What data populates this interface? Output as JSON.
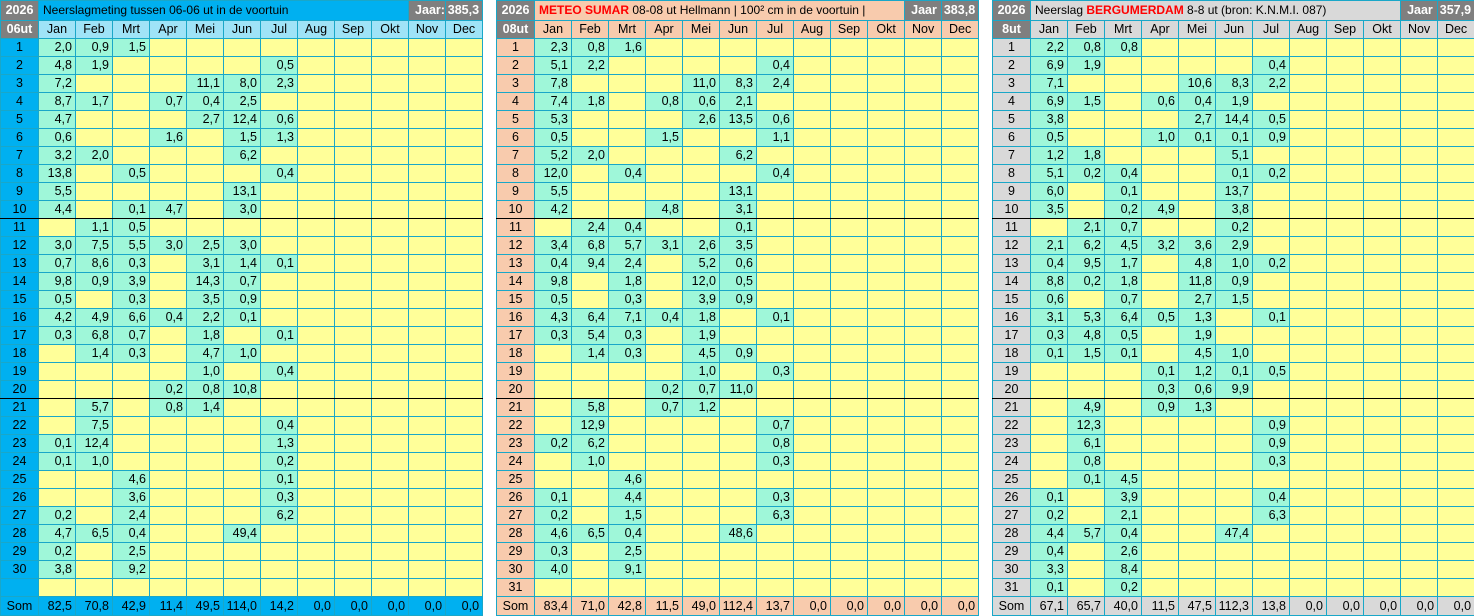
{
  "months": [
    "Jan",
    "Feb",
    "Mrt",
    "Apr",
    "Mei",
    "Jun",
    "Jul",
    "Aug",
    "Sep",
    "Okt",
    "Nov",
    "Dec"
  ],
  "som_label": "Som",
  "panels": [
    {
      "year": "2026",
      "hour": "06ut",
      "title_pre": "Neerslagmeting tussen 06-06 ut in de voortuin",
      "title_hl": "",
      "title_post": "",
      "jaar_label": "Jaar:",
      "jaar_value": "385,3",
      "rows": [
        [
          "2,0",
          "0,9",
          "1,5",
          "",
          "",
          "",
          "",
          "",
          "",
          "",
          "",
          ""
        ],
        [
          "4,8",
          "1,9",
          "",
          "",
          "",
          "",
          "0,5",
          "",
          "",
          "",
          "",
          ""
        ],
        [
          "7,2",
          "",
          "",
          "",
          "11,1",
          "8,0",
          "2,3",
          "",
          "",
          "",
          "",
          ""
        ],
        [
          "8,7",
          "1,7",
          "",
          "0,7",
          "0,4",
          "2,5",
          "",
          "",
          "",
          "",
          "",
          ""
        ],
        [
          "4,7",
          "",
          "",
          "",
          "2,7",
          "12,4",
          "0,6",
          "",
          "",
          "",
          "",
          ""
        ],
        [
          "0,6",
          "",
          "",
          "1,6",
          "",
          "1,5",
          "1,3",
          "",
          "",
          "",
          "",
          ""
        ],
        [
          "3,2",
          "2,0",
          "",
          "",
          "",
          "6,2",
          "",
          "",
          "",
          "",
          "",
          ""
        ],
        [
          "13,8",
          "",
          "0,5",
          "",
          "",
          "",
          "0,4",
          "",
          "",
          "",
          "",
          ""
        ],
        [
          "5,5",
          "",
          "",
          "",
          "",
          "13,1",
          "",
          "",
          "",
          "",
          "",
          ""
        ],
        [
          "4,4",
          "",
          "0,1",
          "4,7",
          "",
          "3,0",
          "",
          "",
          "",
          "",
          "",
          ""
        ],
        [
          "",
          "1,1",
          "0,5",
          "",
          "",
          "",
          "",
          "",
          "",
          "",
          "",
          ""
        ],
        [
          "3,0",
          "7,5",
          "5,5",
          "3,0",
          "2,5",
          "3,0",
          "",
          "",
          "",
          "",
          "",
          ""
        ],
        [
          "0,7",
          "8,6",
          "0,3",
          "",
          "3,1",
          "1,4",
          "0,1",
          "",
          "",
          "",
          "",
          ""
        ],
        [
          "9,8",
          "0,9",
          "3,9",
          "",
          "14,3",
          "0,7",
          "",
          "",
          "",
          "",
          "",
          ""
        ],
        [
          "0,5",
          "",
          "0,3",
          "",
          "3,5",
          "0,9",
          "",
          "",
          "",
          "",
          "",
          ""
        ],
        [
          "4,2",
          "4,9",
          "6,6",
          "0,4",
          "2,2",
          "0,1",
          "",
          "",
          "",
          "",
          "",
          ""
        ],
        [
          "0,3",
          "6,8",
          "0,7",
          "",
          "1,8",
          "",
          "0,1",
          "",
          "",
          "",
          "",
          ""
        ],
        [
          "",
          "1,4",
          "0,3",
          "",
          "4,7",
          "1,0",
          "",
          "",
          "",
          "",
          "",
          ""
        ],
        [
          "",
          "",
          "",
          "",
          "1,0",
          "",
          "0,4",
          "",
          "",
          "",
          "",
          ""
        ],
        [
          "",
          "",
          "",
          "0,2",
          "0,8",
          "10,8",
          "",
          "",
          "",
          "",
          "",
          ""
        ],
        [
          "",
          "5,7",
          "",
          "0,8",
          "1,4",
          "",
          "",
          "",
          "",
          "",
          "",
          ""
        ],
        [
          "",
          "7,5",
          "",
          "",
          "",
          "",
          "0,4",
          "",
          "",
          "",
          "",
          ""
        ],
        [
          "0,1",
          "12,4",
          "",
          "",
          "",
          "",
          "1,3",
          "",
          "",
          "",
          "",
          ""
        ],
        [
          "0,1",
          "1,0",
          "",
          "",
          "",
          "",
          "0,2",
          "",
          "",
          "",
          "",
          ""
        ],
        [
          "",
          "",
          "4,6",
          "",
          "",
          "",
          "0,1",
          "",
          "",
          "",
          "",
          ""
        ],
        [
          "",
          "",
          "3,6",
          "",
          "",
          "",
          "0,3",
          "",
          "",
          "",
          "",
          ""
        ],
        [
          "0,2",
          "",
          "2,4",
          "",
          "",
          "",
          "6,2",
          "",
          "",
          "",
          "",
          ""
        ],
        [
          "4,7",
          "6,5",
          "0,4",
          "",
          "",
          "49,4",
          "",
          "",
          "",
          "",
          "",
          ""
        ],
        [
          "0,2",
          "",
          "2,5",
          "",
          "",
          "",
          "",
          "",
          "",
          "",
          "",
          ""
        ],
        [
          "3,8",
          "",
          "9,2",
          "",
          "",
          "",
          "",
          "",
          "",
          "",
          "",
          ""
        ]
      ],
      "totals": [
        "82,5",
        "70,8",
        "42,9",
        "11,4",
        "49,5",
        "114,0",
        "14,2",
        "0,0",
        "0,0",
        "0,0",
        "0,0",
        "0,0"
      ]
    },
    {
      "year": "2026",
      "hour": "08ut",
      "title_pre": "",
      "title_hl": "METEO SUMAR",
      "title_post": " 08-08 ut Hellmann | 100² cm in de voortuin |",
      "jaar_label": "Jaar",
      "jaar_value": "383,8",
      "rows": [
        [
          "2,3",
          "0,8",
          "1,6",
          "",
          "",
          "",
          "",
          "",
          "",
          "",
          "",
          ""
        ],
        [
          "5,1",
          "2,2",
          "",
          "",
          "",
          "",
          "0,4",
          "",
          "",
          "",
          "",
          ""
        ],
        [
          "7,8",
          "",
          "",
          "",
          "11,0",
          "8,3",
          "2,4",
          "",
          "",
          "",
          "",
          ""
        ],
        [
          "7,4",
          "1,8",
          "",
          "0,8",
          "0,6",
          "2,1",
          "",
          "",
          "",
          "",
          "",
          ""
        ],
        [
          "5,3",
          "",
          "",
          "",
          "2,6",
          "13,5",
          "0,6",
          "",
          "",
          "",
          "",
          ""
        ],
        [
          "0,5",
          "",
          "",
          "1,5",
          "",
          "",
          "1,1",
          "",
          "",
          "",
          "",
          ""
        ],
        [
          "5,2",
          "2,0",
          "",
          "",
          "",
          "6,2",
          "",
          "",
          "",
          "",
          "",
          ""
        ],
        [
          "12,0",
          "",
          "0,4",
          "",
          "",
          "",
          "0,4",
          "",
          "",
          "",
          "",
          ""
        ],
        [
          "5,5",
          "",
          "",
          "",
          "",
          "13,1",
          "",
          "",
          "",
          "",
          "",
          ""
        ],
        [
          "4,2",
          "",
          "",
          "4,8",
          "",
          "3,1",
          "",
          "",
          "",
          "",
          "",
          ""
        ],
        [
          "",
          "2,4",
          "0,4",
          "",
          "",
          "0,1",
          "",
          "",
          "",
          "",
          "",
          ""
        ],
        [
          "3,4",
          "6,8",
          "5,7",
          "3,1",
          "2,6",
          "3,5",
          "",
          "",
          "",
          "",
          "",
          ""
        ],
        [
          "0,4",
          "9,4",
          "2,4",
          "",
          "5,2",
          "0,6",
          "",
          "",
          "",
          "",
          "",
          ""
        ],
        [
          "9,8",
          "",
          "1,8",
          "",
          "12,0",
          "0,5",
          "",
          "",
          "",
          "",
          "",
          ""
        ],
        [
          "0,5",
          "",
          "0,3",
          "",
          "3,9",
          "0,9",
          "",
          "",
          "",
          "",
          "",
          ""
        ],
        [
          "4,3",
          "6,4",
          "7,1",
          "0,4",
          "1,8",
          "",
          "0,1",
          "",
          "",
          "",
          "",
          ""
        ],
        [
          "0,3",
          "5,4",
          "0,3",
          "",
          "1,9",
          "",
          "",
          "",
          "",
          "",
          "",
          ""
        ],
        [
          "",
          "1,4",
          "0,3",
          "",
          "4,5",
          "0,9",
          "",
          "",
          "",
          "",
          "",
          ""
        ],
        [
          "",
          "",
          "",
          "",
          "1,0",
          "",
          "0,3",
          "",
          "",
          "",
          "",
          ""
        ],
        [
          "",
          "",
          "",
          "0,2",
          "0,7",
          "11,0",
          "",
          "",
          "",
          "",
          "",
          ""
        ],
        [
          "",
          "5,8",
          "",
          "0,7",
          "1,2",
          "",
          "",
          "",
          "",
          "",
          "",
          ""
        ],
        [
          "",
          "12,9",
          "",
          "",
          "",
          "",
          "0,7",
          "",
          "",
          "",
          "",
          ""
        ],
        [
          "0,2",
          "6,2",
          "",
          "",
          "",
          "",
          "0,8",
          "",
          "",
          "",
          "",
          ""
        ],
        [
          "",
          "1,0",
          "",
          "",
          "",
          "",
          "0,3",
          "",
          "",
          "",
          "",
          ""
        ],
        [
          "",
          "",
          "4,6",
          "",
          "",
          "",
          "",
          "",
          "",
          "",
          "",
          ""
        ],
        [
          "0,1",
          "",
          "4,4",
          "",
          "",
          "",
          "0,3",
          "",
          "",
          "",
          "",
          ""
        ],
        [
          "0,2",
          "",
          "1,5",
          "",
          "",
          "",
          "6,3",
          "",
          "",
          "",
          "",
          ""
        ],
        [
          "4,6",
          "6,5",
          "0,4",
          "",
          "",
          "48,6",
          "",
          "",
          "",
          "",
          "",
          ""
        ],
        [
          "0,3",
          "",
          "2,5",
          "",
          "",
          "",
          "",
          "",
          "",
          "",
          "",
          ""
        ],
        [
          "4,0",
          "",
          "9,1",
          "",
          "",
          "",
          "",
          "",
          "",
          "",
          "",
          ""
        ],
        [
          "",
          "",
          "",
          "",
          "",
          "",
          "",
          "",
          "",
          "",
          "",
          ""
        ]
      ],
      "totals": [
        "83,4",
        "71,0",
        "42,8",
        "11,5",
        "49,0",
        "112,4",
        "13,7",
        "0,0",
        "0,0",
        "0,0",
        "0,0",
        "0,0"
      ]
    },
    {
      "year": "2026",
      "hour": "8ut",
      "title_pre": "Neerslag ",
      "title_hl": "BERGUMERDAM",
      "title_post": "  8-8 ut (bron: K.N.M.I. 087)",
      "jaar_label": "Jaar",
      "jaar_value": "357,9",
      "rows": [
        [
          "2,2",
          "0,8",
          "0,8",
          "",
          "",
          "",
          "",
          "",
          "",
          "",
          "",
          ""
        ],
        [
          "6,9",
          "1,9",
          "",
          "",
          "",
          "",
          "0,4",
          "",
          "",
          "",
          "",
          ""
        ],
        [
          "7,1",
          "",
          "",
          "",
          "10,6",
          "8,3",
          "2,2",
          "",
          "",
          "",
          "",
          ""
        ],
        [
          "6,9",
          "1,5",
          "",
          "0,6",
          "0,4",
          "1,9",
          "",
          "",
          "",
          "",
          "",
          ""
        ],
        [
          "3,8",
          "",
          "",
          "",
          "2,7",
          "14,4",
          "0,5",
          "",
          "",
          "",
          "",
          ""
        ],
        [
          "0,5",
          "",
          "",
          "1,0",
          "0,1",
          "0,1",
          "0,9",
          "",
          "",
          "",
          "",
          ""
        ],
        [
          "1,2",
          "1,8",
          "",
          "",
          "",
          "5,1",
          "",
          "",
          "",
          "",
          "",
          ""
        ],
        [
          "5,1",
          "0,2",
          "0,4",
          "",
          "",
          "0,1",
          "0,2",
          "",
          "",
          "",
          "",
          ""
        ],
        [
          "6,0",
          "",
          "0,1",
          "",
          "",
          "13,7",
          "",
          "",
          "",
          "",
          "",
          ""
        ],
        [
          "3,5",
          "",
          "0,2",
          "4,9",
          "",
          "3,8",
          "",
          "",
          "",
          "",
          "",
          ""
        ],
        [
          "",
          "2,1",
          "0,7",
          "",
          "",
          "0,2",
          "",
          "",
          "",
          "",
          "",
          ""
        ],
        [
          "2,1",
          "6,2",
          "4,5",
          "3,2",
          "3,6",
          "2,9",
          "",
          "",
          "",
          "",
          "",
          ""
        ],
        [
          "0,4",
          "9,5",
          "1,7",
          "",
          "4,8",
          "1,0",
          "0,2",
          "",
          "",
          "",
          "",
          ""
        ],
        [
          "8,8",
          "0,2",
          "1,8",
          "",
          "11,8",
          "0,9",
          "",
          "",
          "",
          "",
          "",
          ""
        ],
        [
          "0,6",
          "",
          "0,7",
          "",
          "2,7",
          "1,5",
          "",
          "",
          "",
          "",
          "",
          ""
        ],
        [
          "3,1",
          "5,3",
          "6,4",
          "0,5",
          "1,3",
          "",
          "0,1",
          "",
          "",
          "",
          "",
          ""
        ],
        [
          "0,3",
          "4,8",
          "0,5",
          "",
          "1,9",
          "",
          "",
          "",
          "",
          "",
          "",
          ""
        ],
        [
          "0,1",
          "1,5",
          "0,1",
          "",
          "4,5",
          "1,0",
          "",
          "",
          "",
          "",
          "",
          ""
        ],
        [
          "",
          "",
          "",
          "0,1",
          "1,2",
          "0,1",
          "0,5",
          "",
          "",
          "",
          "",
          ""
        ],
        [
          "",
          "",
          "",
          "0,3",
          "0,6",
          "9,9",
          "",
          "",
          "",
          "",
          "",
          ""
        ],
        [
          "",
          "4,9",
          "",
          "0,9",
          "1,3",
          "",
          "",
          "",
          "",
          "",
          "",
          ""
        ],
        [
          "",
          "12,3",
          "",
          "",
          "",
          "",
          "0,9",
          "",
          "",
          "",
          "",
          ""
        ],
        [
          "",
          "6,1",
          "",
          "",
          "",
          "",
          "0,9",
          "",
          "",
          "",
          "",
          ""
        ],
        [
          "",
          "0,8",
          "",
          "",
          "",
          "",
          "0,3",
          "",
          "",
          "",
          "",
          ""
        ],
        [
          "",
          "0,1",
          "4,5",
          "",
          "",
          "",
          "",
          "",
          "",
          "",
          "",
          ""
        ],
        [
          "0,1",
          "",
          "3,9",
          "",
          "",
          "",
          "0,4",
          "",
          "",
          "",
          "",
          ""
        ],
        [
          "0,2",
          "",
          "2,1",
          "",
          "",
          "",
          "6,3",
          "",
          "",
          "",
          "",
          ""
        ],
        [
          "4,4",
          "5,7",
          "0,4",
          "",
          "",
          "47,4",
          "",
          "",
          "",
          "",
          "",
          ""
        ],
        [
          "0,4",
          "",
          "2,6",
          "",
          "",
          "",
          "",
          "",
          "",
          "",
          "",
          ""
        ],
        [
          "3,3",
          "",
          "8,4",
          "",
          "",
          "",
          "",
          "",
          "",
          "",
          "",
          ""
        ],
        [
          "0,1",
          "",
          "0,2",
          "",
          "",
          "",
          "",
          "",
          "",
          "",
          "",
          ""
        ]
      ],
      "totals": [
        "67,1",
        "65,7",
        "40,0",
        "11,5",
        "47,5",
        "112,3",
        "13,8",
        "0,0",
        "0,0",
        "0,0",
        "0,0",
        "0,0"
      ]
    }
  ]
}
